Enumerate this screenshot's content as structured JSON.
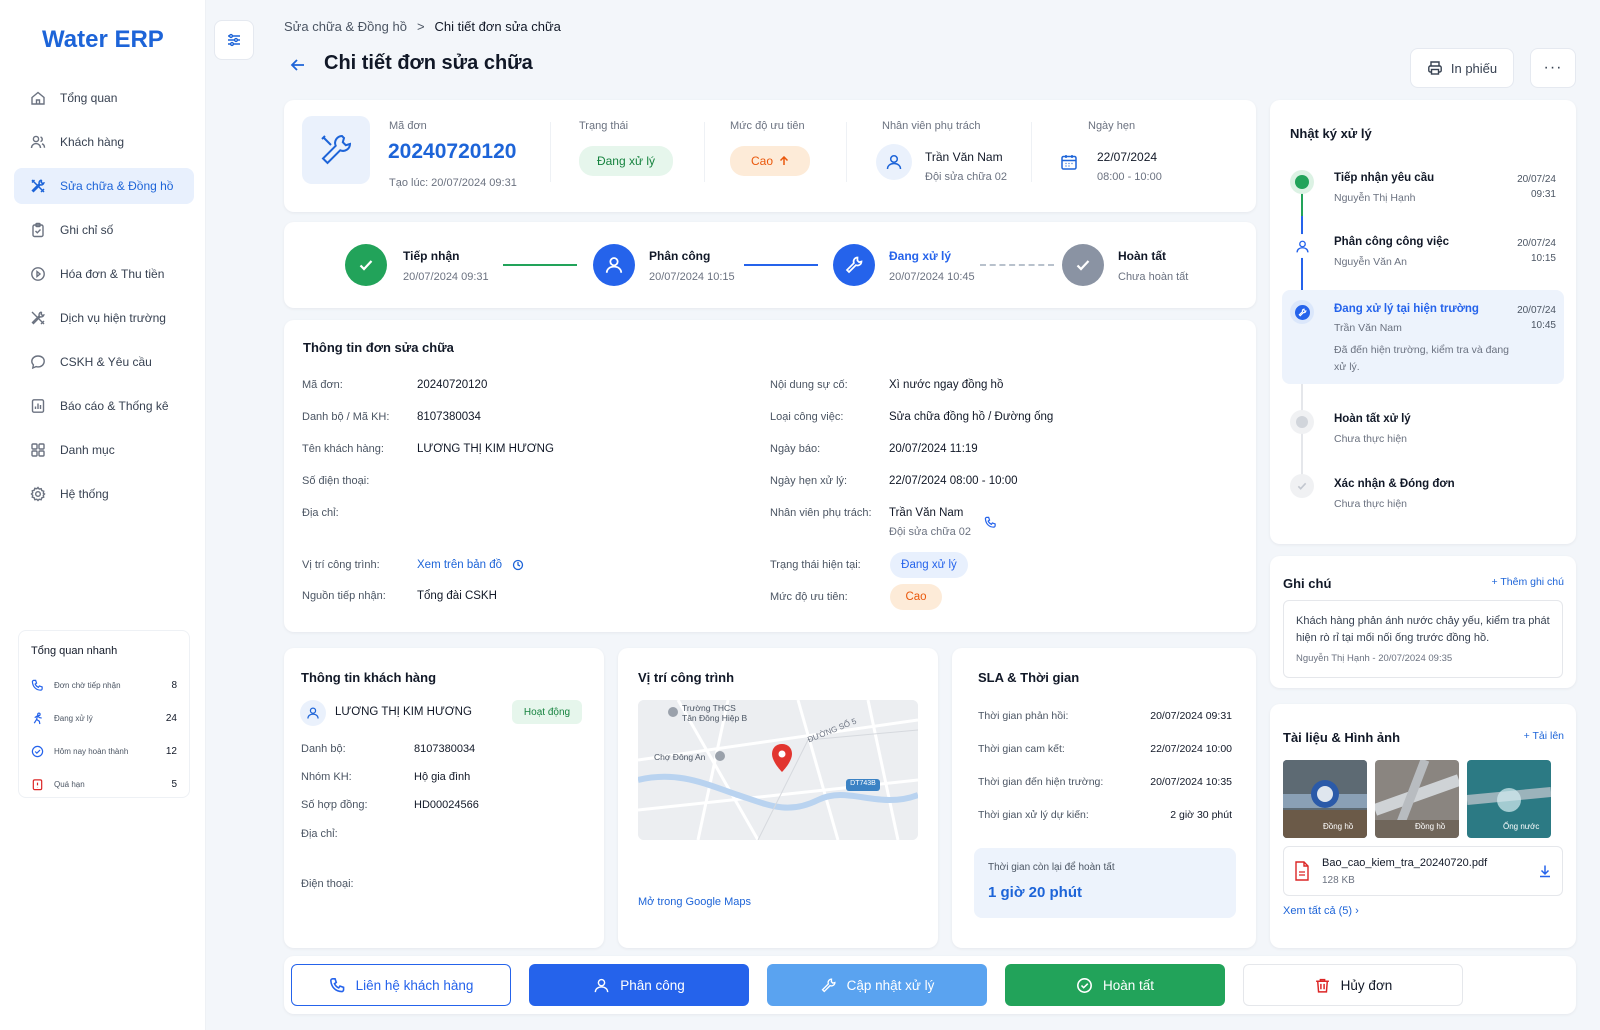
{
  "app": {
    "title": "Water ERP"
  },
  "nav": [
    {
      "label": "Tổng quan",
      "icon": "home-icon"
    },
    {
      "label": "Khách hàng",
      "icon": "users-icon"
    },
    {
      "label": "Sửa chữa & Đồng hồ",
      "icon": "tools-icon",
      "active": true
    },
    {
      "label": "Ghi chỉ số",
      "icon": "clipboard-icon"
    },
    {
      "label": "Hóa đơn & Thu tiền",
      "icon": "payment-icon"
    },
    {
      "label": "Dịch vụ hiện trường",
      "icon": "field-service-icon"
    },
    {
      "label": "CSKH & Yêu cầu",
      "icon": "chat-icon"
    },
    {
      "label": "Báo cáo & Thống kê",
      "icon": "report-icon"
    },
    {
      "label": "Danh mục",
      "icon": "grid-icon"
    },
    {
      "label": "Hệ thống",
      "icon": "gear-icon"
    }
  ],
  "quick": {
    "title": "Tổng quan nhanh",
    "items": [
      {
        "label": "Đơn chờ tiếp nhận",
        "count": "8",
        "color": "#2563eb"
      },
      {
        "label": "Đang xử lý",
        "count": "24",
        "color": "#2563eb"
      },
      {
        "label": "Hôm nay hoàn thành",
        "count": "12",
        "color": "#2563eb"
      },
      {
        "label": "Quá hạn",
        "count": "5",
        "color": "#dc2626"
      }
    ]
  },
  "breadcrumb": {
    "parent": "Sửa chữa & Đồng hồ",
    "sep": ">",
    "current": "Chi tiết đơn sửa chữa"
  },
  "page": {
    "title": "Chi tiết đơn sửa chữa",
    "print": "In phiếu",
    "more": "···"
  },
  "summary": {
    "code_label": "Mã đơn",
    "code": "20240720120",
    "created": "Tạo lúc: 20/07/2024 09:31",
    "status_label": "Trạng thái",
    "status": "Đang xử lý",
    "priority_label": "Mức độ ưu tiên",
    "priority": "Cao",
    "staff_label": "Nhân viên phụ trách",
    "staff": "Trần Văn Nam",
    "team": "Đội sửa chữa 02",
    "appt_label": "Ngày hẹn",
    "appt_date": "22/07/2024",
    "appt_time": "08:00 - 10:00"
  },
  "steps": [
    {
      "title": "Tiếp nhận",
      "time": "20/07/2024 09:31"
    },
    {
      "title": "Phân công",
      "time": "20/07/2024 10:15"
    },
    {
      "title": "Đang xử lý",
      "time": "20/07/2024 10:45"
    },
    {
      "title": "Hoàn tất",
      "time": "Chưa hoàn tất"
    }
  ],
  "info": {
    "title": "Thông tin đơn sửa chữa",
    "left": [
      {
        "k": "Mã đơn:",
        "v": "20240720120"
      },
      {
        "k": "Danh bộ / Mã KH:",
        "v": "8107380034"
      },
      {
        "k": "Tên khách hàng:",
        "v": "LƯƠNG THỊ KIM HƯƠNG"
      },
      {
        "k": "Số điện thoại:",
        "v": ""
      },
      {
        "k": "Địa chỉ:",
        "v": ""
      },
      {
        "k": "Vị trí công trình:",
        "v": "Xem trên bản đồ"
      },
      {
        "k": "Nguồn tiếp nhận:",
        "v": "Tổng đài CSKH"
      }
    ],
    "right": [
      {
        "k": "Nội dung sự cố:",
        "v": "Xì nước ngay đồng hồ"
      },
      {
        "k": "Loại công việc:",
        "v": "Sửa chữa đồng hồ / Đường ống"
      },
      {
        "k": "Ngày báo:",
        "v": "20/07/2024 11:19"
      },
      {
        "k": "Ngày hẹn xử lý:",
        "v": "22/07/2024 08:00 - 10:00"
      },
      {
        "k": "Nhân viên phụ trách:",
        "v": "Trần Văn Nam",
        "v2": "Đội sửa chữa 02"
      },
      {
        "k": "Trạng thái hiện tại:",
        "v": "Đang xử lý"
      },
      {
        "k": "Mức độ ưu tiên:",
        "v": "Cao"
      }
    ]
  },
  "customer": {
    "title": "Thông tin khách hàng",
    "name": "LƯƠNG THỊ KIM HƯƠNG",
    "badge": "Hoạt động",
    "rows": [
      {
        "k": "Danh bộ:",
        "v": "8107380034"
      },
      {
        "k": "Nhóm KH:",
        "v": "Hộ gia đình"
      },
      {
        "k": "Số hợp đồng:",
        "v": "HD00024566"
      },
      {
        "k": "Địa chỉ:",
        "v": ""
      },
      {
        "k": "Điện thoại:",
        "v": ""
      }
    ]
  },
  "location": {
    "title": "Vị trí công trình",
    "poi1": "Trường THCS",
    "poi1b": "Tân Đông Hiệp B",
    "poi2": "Chợ Đông An",
    "road": "ĐƯỜNG SỐ 5",
    "shield": "DT743B",
    "link": "Mở trong Google Maps"
  },
  "sla": {
    "title": "SLA & Thời gian",
    "rows": [
      {
        "k": "Thời gian phản hồi:",
        "v": "20/07/2024 09:31"
      },
      {
        "k": "Thời gian cam kết:",
        "v": "22/07/2024 10:00"
      },
      {
        "k": "Thời gian đến hiện trường:",
        "v": "20/07/2024 10:35"
      },
      {
        "k": "Thời gian xử lý dự kiến:",
        "v": "2 giờ 30 phút"
      }
    ],
    "remain_label": "Thời gian còn lại để hoàn tất",
    "remain": "1 giờ 20 phút"
  },
  "log": {
    "title": "Nhật ký xử lý",
    "items": [
      {
        "title": "Tiếp nhận yêu cầu",
        "who": "Nguyễn Thị Hạnh",
        "date": "20/07/24",
        "time": "09:31"
      },
      {
        "title": "Phân công công việc",
        "who": "Nguyễn Văn An",
        "date": "20/07/24",
        "time": "10:15"
      },
      {
        "title": "Đang xử lý tại hiện trường",
        "who": "Trần Văn Nam",
        "date": "20/07/24",
        "time": "10:45",
        "note": "Đã đến hiện trường, kiểm tra và đang xử lý."
      },
      {
        "title": "Hoàn tất xử lý",
        "who": "Chưa thực hiện"
      },
      {
        "title": "Xác nhận & Đóng đơn",
        "who": "Chưa thực hiện"
      }
    ]
  },
  "notes": {
    "title": "Ghi chú",
    "add": "+ Thêm ghi chú",
    "text": "Khách hàng phản ánh nước chảy yếu, kiểm tra phát hiện rò rỉ tại mối nối ống trước đồng hồ.",
    "meta": "Nguyễn Thị Hạnh - 20/07/2024 09:35"
  },
  "docs": {
    "title": "Tài liệu & Hình ảnh",
    "upload": "+ Tải lên",
    "photo_labels": [
      "Đồng hồ",
      "Đồng hồ",
      "Ống nước"
    ],
    "file": "Bao_cao_kiem_tra_20240720.pdf",
    "size": "128 KB",
    "view_all": "Xem tất cả (5) ›"
  },
  "actions": {
    "contact": "Liên hệ khách hàng",
    "assign": "Phân công",
    "update": "Cập nhật xử lý",
    "complete": "Hoàn tất",
    "cancel": "Hủy đơn"
  },
  "colors": {
    "primary": "#2563eb",
    "success": "#22a35a",
    "warning": "#f97316",
    "danger": "#dc2626"
  }
}
